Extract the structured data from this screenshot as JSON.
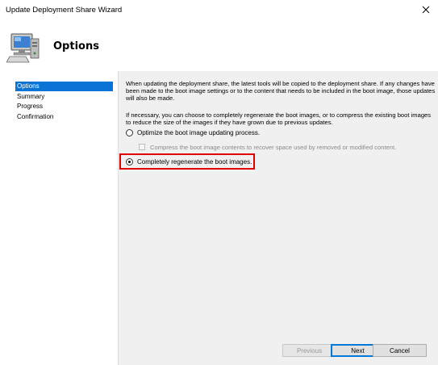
{
  "window": {
    "title": "Update Deployment Share Wizard"
  },
  "header": {
    "title": "Options"
  },
  "nav": {
    "items": [
      {
        "label": "Options",
        "active": true
      },
      {
        "label": "Summary",
        "active": false
      },
      {
        "label": "Progress",
        "active": false
      },
      {
        "label": "Confirmation",
        "active": false
      }
    ]
  },
  "content": {
    "para1": "When updating the deployment share, the latest tools will be copied to the deployment share.  If any changes have been made to the boot image settings or to the content that needs to be included in the boot image, those updates will also be made.",
    "para2": "If necessary, you can choose to completely regenerate the boot images, or to compress the existing boot images to reduce the size of the images if they have grown due to previous updates.",
    "option_optimize": "Optimize the boot image updating process.",
    "option_compress": "Compress the boot image contents to recover space used by removed or modified content.",
    "option_regenerate": "Completely regenerate the boot images.",
    "selected_option": "regenerate"
  },
  "buttons": {
    "previous": "Previous",
    "next": "Next",
    "cancel": "Cancel"
  },
  "colors": {
    "accent": "#0a74d6",
    "highlight": "#e00000",
    "panel": "#f0f0f0"
  }
}
